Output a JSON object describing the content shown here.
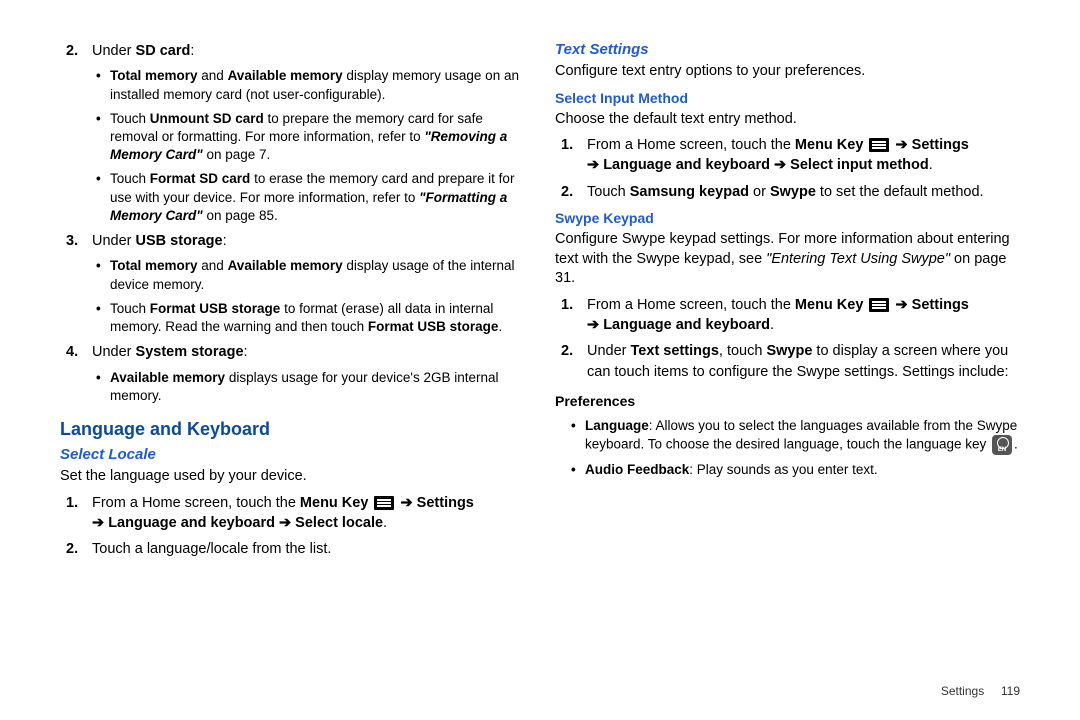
{
  "left": {
    "sd_title_pre": "Under ",
    "sd_title_bold": "SD card",
    "sd_b1_a": "Total memory",
    "sd_b1_mid": " and ",
    "sd_b1_b": "Available memory",
    "sd_b1_tail": " display memory usage on an installed memory card (not user-configurable).",
    "sd_b2_pre": "Touch ",
    "sd_b2_bold": "Unmount SD card",
    "sd_b2_mid": " to prepare the memory card for safe removal or formatting. For more information, refer to ",
    "sd_b2_ref": "\"Removing a Memory Card\"",
    "sd_b2_tail": " on page 7.",
    "sd_b3_pre": "Touch ",
    "sd_b3_bold": "Format SD card",
    "sd_b3_mid": " to erase the memory card and prepare it for use with your device. For more information, refer to ",
    "sd_b3_ref": "\"Formatting a Memory Card\"",
    "sd_b3_tail": " on page 85.",
    "usb_title_pre": "Under ",
    "usb_title_bold": "USB storage",
    "usb_b1_a": "Total memory",
    "usb_b1_mid": " and ",
    "usb_b1_b": "Available memory",
    "usb_b1_tail": " display usage of the internal device memory.",
    "usb_b2_pre": "Touch ",
    "usb_b2_bold": "Format USB storage",
    "usb_b2_mid": " to format (erase) all data in internal memory. Read the warning and then touch ",
    "usb_b2_bold2": "Format USB storage",
    "usb_b2_tail": ".",
    "sys_title_pre": "Under ",
    "sys_title_bold": "System storage",
    "sys_b1_bold": "Available memory",
    "sys_b1_tail": " displays usage for your device's 2GB internal memory.",
    "lang_heading": "Language and Keyboard",
    "locale_heading": "Select Locale",
    "locale_desc": "Set the language used by your device.",
    "locale_s1_pre": "From a Home screen, touch the ",
    "locale_s1_menu": "Menu Key",
    "locale_s1_arrow": " ➔ ",
    "locale_s1_settings": "Settings",
    "locale_s1_line2_arrow": "➔ ",
    "locale_s1_line2_bold": "Language and keyboard ➔ Select locale",
    "locale_s1_line2_tail": ".",
    "locale_s2": "Touch a language/locale from the list."
  },
  "right": {
    "text_heading": "Text Settings",
    "text_desc": "Configure text entry options to your preferences.",
    "sim_heading": "Select Input Method",
    "sim_desc": "Choose the default text entry method.",
    "sim_s1_pre": "From a Home screen, touch the ",
    "sim_s1_menu": "Menu Key",
    "sim_s1_arrow": " ➔ ",
    "sim_s1_settings": "Settings",
    "sim_s1_line2_arrow": "➔ ",
    "sim_s1_line2_bold": "Language and keyboard ➔ Select input method",
    "sim_s1_line2_tail": ".",
    "sim_s2_pre": "Touch ",
    "sim_s2_b1": "Samsung keypad",
    "sim_s2_mid": " or ",
    "sim_s2_b2": "Swype",
    "sim_s2_tail": " to set the default method.",
    "swype_heading": "Swype Keypad",
    "swype_desc_a": "Configure Swype keypad settings. For more information about entering text with the Swype keypad, see ",
    "swype_desc_ref": "\"Entering Text Using Swype\"",
    "swype_desc_tail": " on page 31.",
    "swype_s1_pre": "From a Home screen, touch the ",
    "swype_s1_menu": "Menu Key",
    "swype_s1_arrow": " ➔ ",
    "swype_s1_settings": "Settings",
    "swype_s1_line2_arrow": "➔ ",
    "swype_s1_line2_bold": "Language and keyboard",
    "swype_s1_line2_tail": ".",
    "swype_s2_pre": "Under ",
    "swype_s2_b1": "Text settings",
    "swype_s2_mid": ", touch ",
    "swype_s2_b2": "Swype",
    "swype_s2_tail": " to display a screen where you can touch items to configure the Swype settings. Settings include:",
    "pref_heading": "Preferences",
    "pref_b1_b": "Language",
    "pref_b1_tail": ": Allows you to select the languages available from the Swype keyboard. To choose the desired language, touch the language key ",
    "pref_b1_tail2": ".",
    "pref_b2_b": "Audio Feedback",
    "pref_b2_tail": ": Play sounds as you enter text."
  },
  "footer": {
    "label": "Settings",
    "page": "119"
  }
}
